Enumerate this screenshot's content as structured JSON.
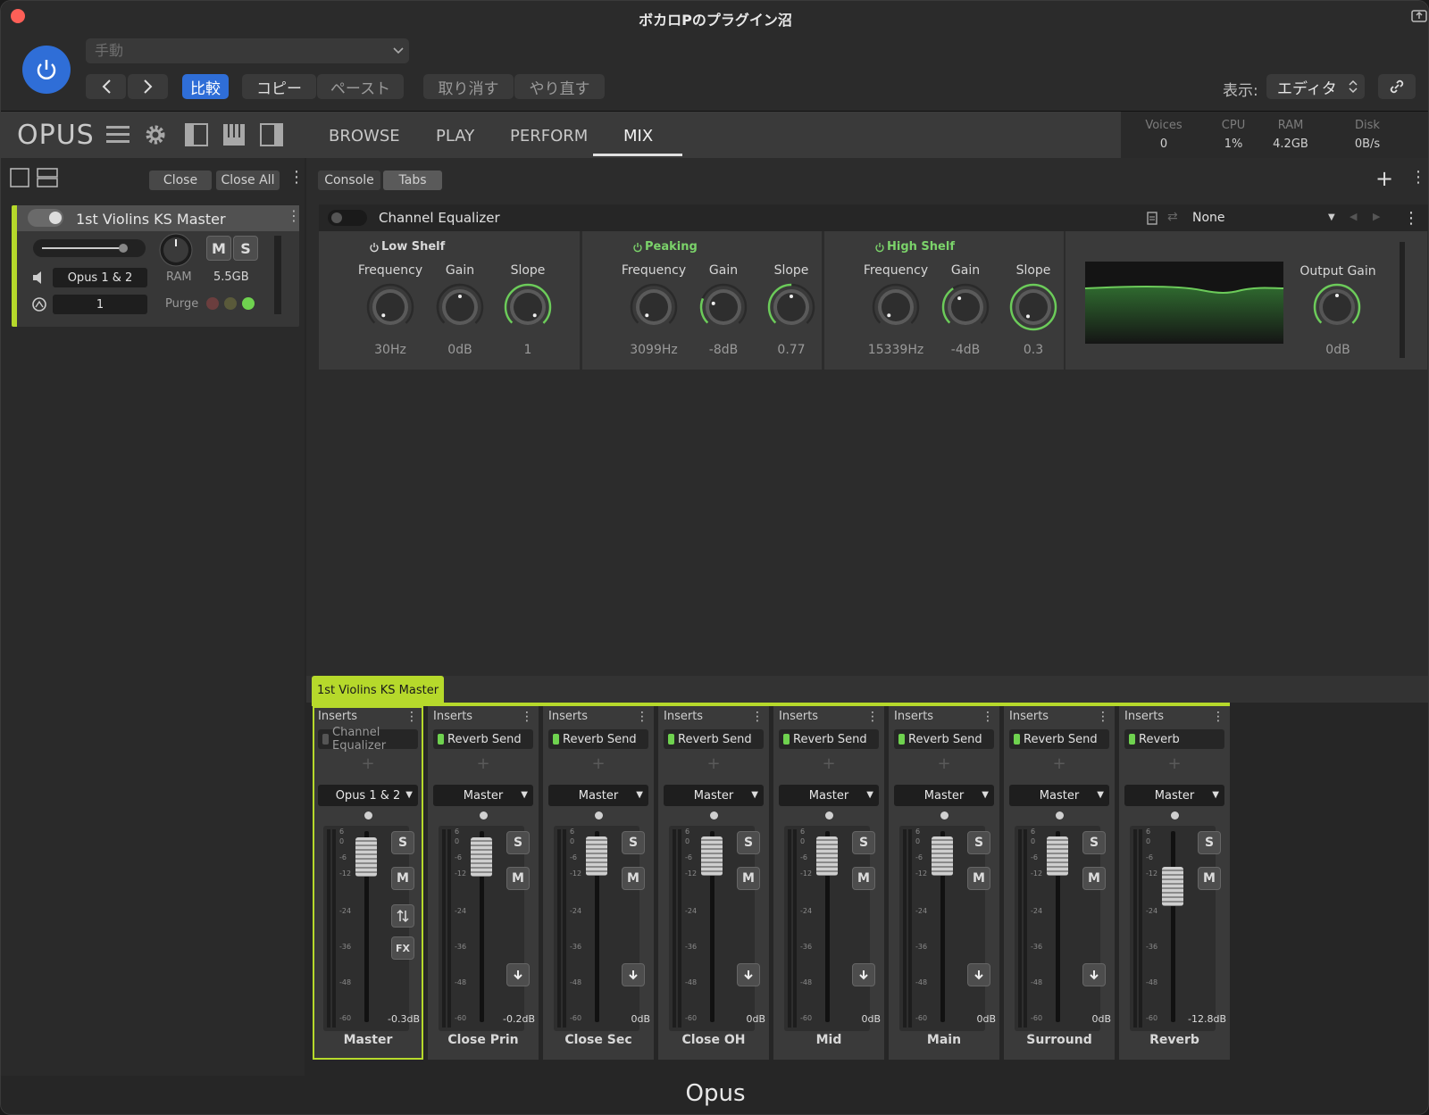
{
  "window": {
    "title": "ボカロPのプラグイン沼",
    "footer": "Opus"
  },
  "host": {
    "preset_placeholder": "手動",
    "compare": "比較",
    "copy": "コピー",
    "paste": "ペースト",
    "undo": "取り消す",
    "redo": "やり直す",
    "view_label": "表示:",
    "view_value": "エディタ"
  },
  "nav": {
    "logo": "OPUS",
    "tabs": [
      "BROWSE",
      "PLAY",
      "PERFORM",
      "MIX"
    ],
    "active_tab": "MIX",
    "stats": [
      {
        "label": "Voices",
        "value": "0"
      },
      {
        "label": "CPU",
        "value": "1%"
      },
      {
        "label": "RAM",
        "value": "4.2GB"
      },
      {
        "label": "Disk",
        "value": "0B/s"
      }
    ]
  },
  "left": {
    "close": "Close",
    "close_all": "Close All",
    "instrument": {
      "name": "1st Violins KS Master",
      "output": "Opus 1 & 2",
      "channel": "1",
      "ram_label": "RAM",
      "ram_value": "5.5GB",
      "purge_label": "Purge",
      "m": "M",
      "s": "S"
    }
  },
  "console": {
    "console_tab": "Console",
    "tabs_tab": "Tabs"
  },
  "eq": {
    "name": "Channel Equalizer",
    "preset": "None",
    "bands": [
      {
        "title": "Low Shelf",
        "color": "#d9d9d9",
        "knobs": [
          {
            "label": "Frequency",
            "value": "30Hz"
          },
          {
            "label": "Gain",
            "value": "0dB"
          },
          {
            "label": "Slope",
            "value": "1"
          }
        ]
      },
      {
        "title": "Peaking",
        "color": "#7bd36a",
        "knobs": [
          {
            "label": "Frequency",
            "value": "3099Hz"
          },
          {
            "label": "Gain",
            "value": "-8dB"
          },
          {
            "label": "Slope",
            "value": "0.77"
          }
        ]
      },
      {
        "title": "High Shelf",
        "color": "#7bd36a",
        "knobs": [
          {
            "label": "Frequency",
            "value": "15339Hz"
          },
          {
            "label": "Gain",
            "value": "-4dB"
          },
          {
            "label": "Slope",
            "value": "0.3"
          }
        ]
      }
    ],
    "output_gain_label": "Output Gain",
    "output_gain_value": "0dB"
  },
  "mixer": {
    "tab": "1st Violins KS Master",
    "inserts_label": "Inserts",
    "scale": [
      "6",
      "0",
      "-6",
      "-12",
      "-24",
      "-36",
      "-48",
      "-60"
    ],
    "strips": [
      {
        "name": "Master",
        "insert": "Channel Equalizer",
        "insert_on": false,
        "output": "Opus 1 & 2",
        "db": "-0.3dB",
        "level_db": -0.3,
        "selected": true
      },
      {
        "name": "Close Prin",
        "insert": "Reverb Send",
        "insert_on": true,
        "output": "Master",
        "db": "-0.2dB",
        "level_db": -0.2
      },
      {
        "name": "Close Sec",
        "insert": "Reverb Send",
        "insert_on": true,
        "output": "Master",
        "db": "0dB",
        "level_db": 0
      },
      {
        "name": "Close OH",
        "insert": "Reverb Send",
        "insert_on": true,
        "output": "Master",
        "db": "0dB",
        "level_db": 0
      },
      {
        "name": "Mid",
        "insert": "Reverb Send",
        "insert_on": true,
        "output": "Master",
        "db": "0dB",
        "level_db": 0
      },
      {
        "name": "Main",
        "insert": "Reverb Send",
        "insert_on": true,
        "output": "Master",
        "db": "0dB",
        "level_db": 0
      },
      {
        "name": "Surround",
        "insert": "Reverb Send",
        "insert_on": true,
        "output": "Master",
        "db": "0dB",
        "level_db": 0
      },
      {
        "name": "Reverb",
        "insert": "Reverb",
        "insert_on": true,
        "output": "Master",
        "db": "-12.8dB",
        "level_db": -12.8
      }
    ],
    "s": "S",
    "m": "M",
    "fx": "FX"
  }
}
